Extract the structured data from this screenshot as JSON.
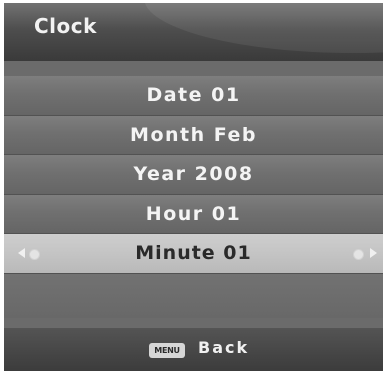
{
  "header": {
    "title": "Clock"
  },
  "settings": [
    {
      "label": "Date 01"
    },
    {
      "label": "Month Feb"
    },
    {
      "label": "Year 2008"
    },
    {
      "label": "Hour 01"
    },
    {
      "label": "Minute 01",
      "selected": true
    }
  ],
  "footer": {
    "menu_key": "MENU",
    "back_label": "Back"
  },
  "colors": {
    "selected_row": "#c4c4c4",
    "row": "#707070",
    "title_bar": "#4e4e4e"
  }
}
